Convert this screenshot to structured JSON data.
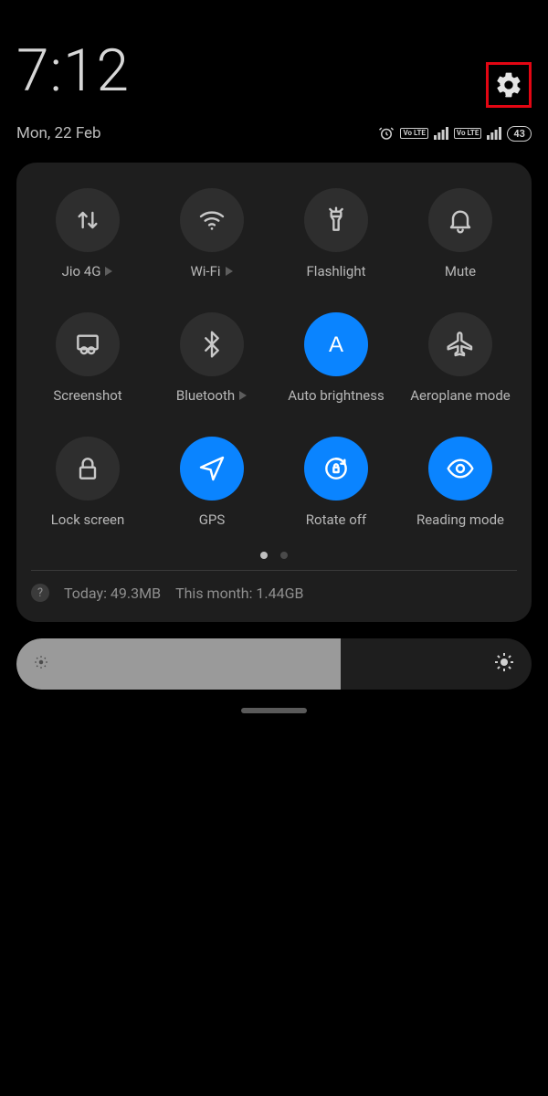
{
  "header": {
    "time": "7:12",
    "date": "Mon, 22 Feb",
    "battery": "43",
    "volte_label": "Vo LTE"
  },
  "panel": {
    "tiles": [
      {
        "id": "mobile-data",
        "label": "Jio 4G",
        "icon": "data-arrows",
        "active": false,
        "chevron": true
      },
      {
        "id": "wifi",
        "label": "Wi-Fi",
        "icon": "wifi",
        "active": false,
        "chevron": true
      },
      {
        "id": "flashlight",
        "label": "Flashlight",
        "icon": "flashlight",
        "active": false,
        "chevron": false
      },
      {
        "id": "mute",
        "label": "Mute",
        "icon": "bell",
        "active": false,
        "chevron": false
      },
      {
        "id": "screenshot",
        "label": "Screenshot",
        "icon": "screenshot",
        "active": false,
        "chevron": false
      },
      {
        "id": "bluetooth",
        "label": "Bluetooth",
        "icon": "bluetooth",
        "active": false,
        "chevron": true
      },
      {
        "id": "auto-bright",
        "label": "Auto brightness",
        "icon": "letter-a",
        "active": true,
        "chevron": false
      },
      {
        "id": "airplane",
        "label": "Aeroplane mode",
        "icon": "airplane",
        "active": false,
        "chevron": false
      },
      {
        "id": "lock",
        "label": "Lock screen",
        "icon": "lock",
        "active": false,
        "chevron": false
      },
      {
        "id": "gps",
        "label": "GPS",
        "icon": "location",
        "active": true,
        "chevron": false
      },
      {
        "id": "rotate",
        "label": "Rotate off",
        "icon": "rotate-lock",
        "active": true,
        "chevron": false
      },
      {
        "id": "reading",
        "label": "Reading mode",
        "icon": "eye",
        "active": true,
        "chevron": false
      }
    ],
    "page_index": 0,
    "page_count": 2,
    "usage": {
      "today": "Today: 49.3MB",
      "month": "This month: 1.44GB"
    }
  },
  "brightness": {
    "percent": 63
  }
}
